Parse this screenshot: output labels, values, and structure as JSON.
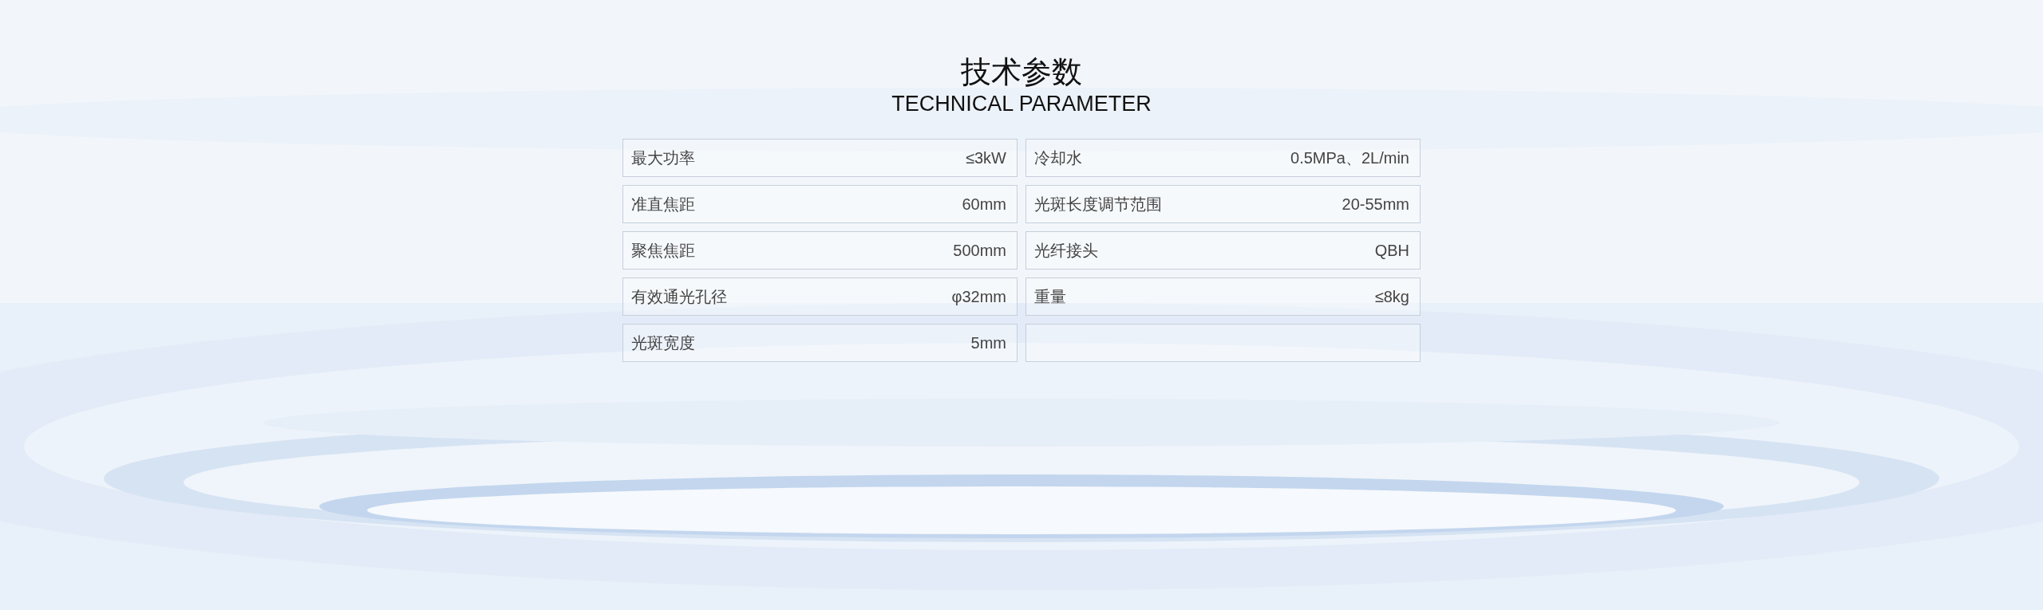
{
  "title": "技术参数",
  "subtitle": "TECHNICAL PARAMETER",
  "params": [
    {
      "kind": "param",
      "label": "最大功率",
      "value": "≤3kW"
    },
    {
      "kind": "param",
      "label": "冷却水",
      "value": "0.5MPa、2L/min"
    },
    {
      "kind": "param",
      "label": "准直焦距",
      "value": "60mm"
    },
    {
      "kind": "param",
      "label": "光斑长度调节范围",
      "value": "20-55mm"
    },
    {
      "kind": "param",
      "label": "聚焦焦距",
      "value": "500mm"
    },
    {
      "kind": "param",
      "label": "光纤接头",
      "value": "QBH"
    },
    {
      "kind": "param",
      "label": "有效通光孔径",
      "value": "φ32mm"
    },
    {
      "kind": "param",
      "label": "重量",
      "value": "≤8kg"
    },
    {
      "kind": "param",
      "label": "光斑宽度",
      "value": "5mm"
    },
    {
      "kind": "empty"
    }
  ]
}
